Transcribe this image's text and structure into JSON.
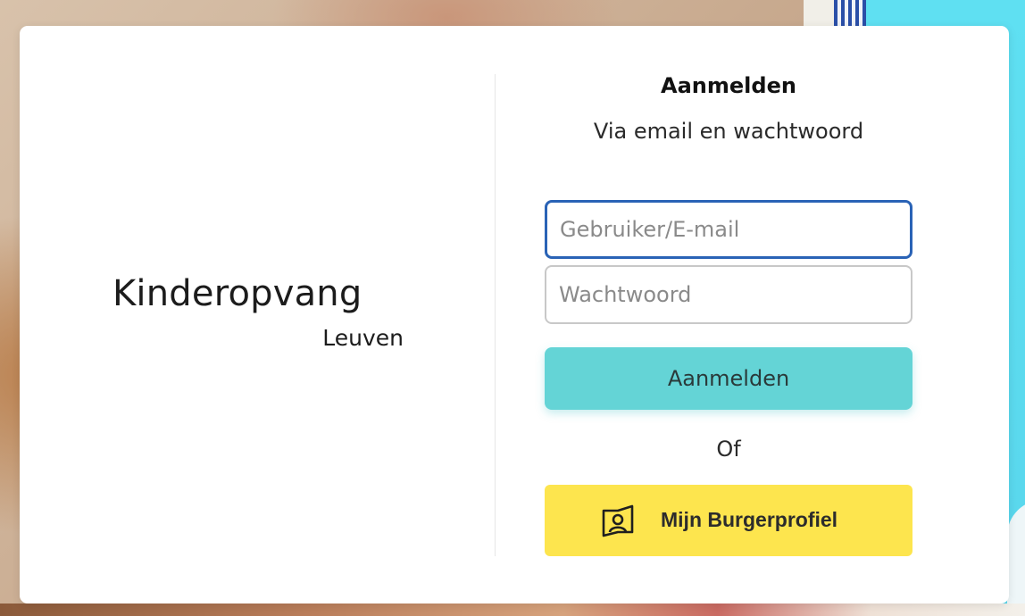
{
  "brand": {
    "name": "Kinderopvang",
    "city": "Leuven"
  },
  "login": {
    "title": "Aanmelden",
    "subtitle": "Via email en wachtwoord",
    "username_placeholder": "Gebruiker/E-mail",
    "password_placeholder": "Wachtwoord",
    "submit_label": "Aanmelden",
    "or_label": "Of",
    "burgerprofiel_label": "Mijn Burgerprofiel",
    "burgerprofiel_icon": "burgerprofiel-icon"
  },
  "colors": {
    "focus_border": "#2a63b6",
    "login_button": "#64d4d6",
    "burgerprofiel_button": "#fde54e"
  }
}
